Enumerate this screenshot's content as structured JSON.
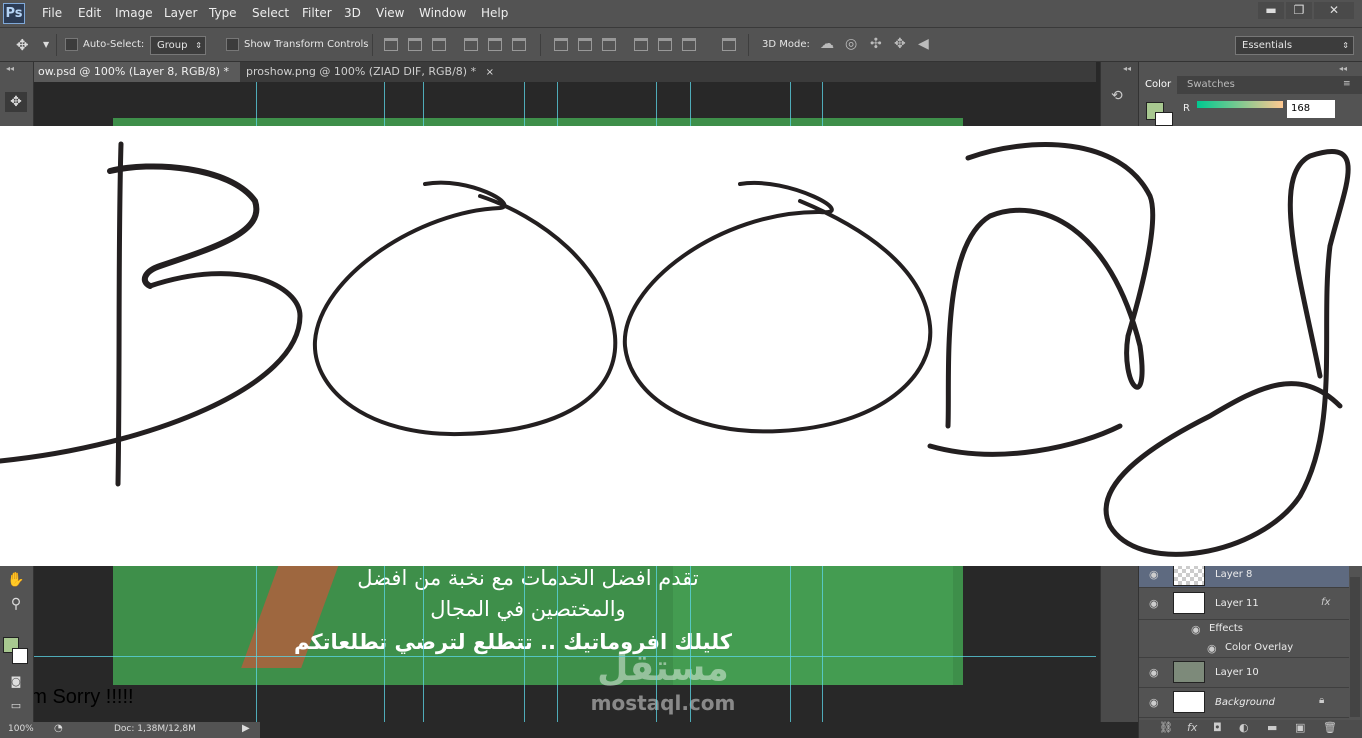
{
  "app": {
    "logo": "Ps"
  },
  "menu": [
    "File",
    "Edit",
    "Image",
    "Layer",
    "Type",
    "Select",
    "Filter",
    "3D",
    "View",
    "Window",
    "Help"
  ],
  "window_controls": {
    "minimize": "▬",
    "restore": "❐",
    "close": "✕"
  },
  "options_bar": {
    "auto_select_label": "Auto-Select:",
    "auto_select_value": "Group",
    "transform_label": "Show Transform Controls",
    "mode_3d_label": "3D Mode:",
    "workspace": "Essentials"
  },
  "tabs": [
    {
      "label": "ow.psd @ 100% (Layer 8, RGB/8) *",
      "close": "×"
    },
    {
      "label": "proshow.png @ 100% (ZIAD DIF, RGB/8) *",
      "close": "×"
    }
  ],
  "canvas": {
    "arabic_line1": "تقدم افضل الخدمات مع نخبة من افضل",
    "arabic_line2": "والمختصين في المجال",
    "arabic_line3": "كليلك افروماتيك .. تتطلع لترضي تطلعاتكم",
    "watermark_arabic": "مستقل",
    "watermark_latin": "mostaql.com",
    "sorry_text": "I am Sorry !!!!!"
  },
  "panels": {
    "collapse": "◂◂",
    "color_tab": "Color",
    "swatches_tab": "Swatches",
    "channel_label": "R",
    "channel_value": "168",
    "fg_color": "#a8c890"
  },
  "layers": [
    {
      "name": "Layer 8",
      "selected": true
    },
    {
      "name": "Layer 11",
      "fx": "fx"
    },
    {
      "name": "Effects",
      "indent": 1
    },
    {
      "name": "Color Overlay",
      "indent": 2
    },
    {
      "name": "Layer 10"
    },
    {
      "name": "Background",
      "italic": true
    }
  ],
  "status": {
    "zoom": "100%",
    "doc": "Doc: 1,38M/12,8M"
  },
  "overlay": {
    "handwritten_word": "BOODY"
  }
}
